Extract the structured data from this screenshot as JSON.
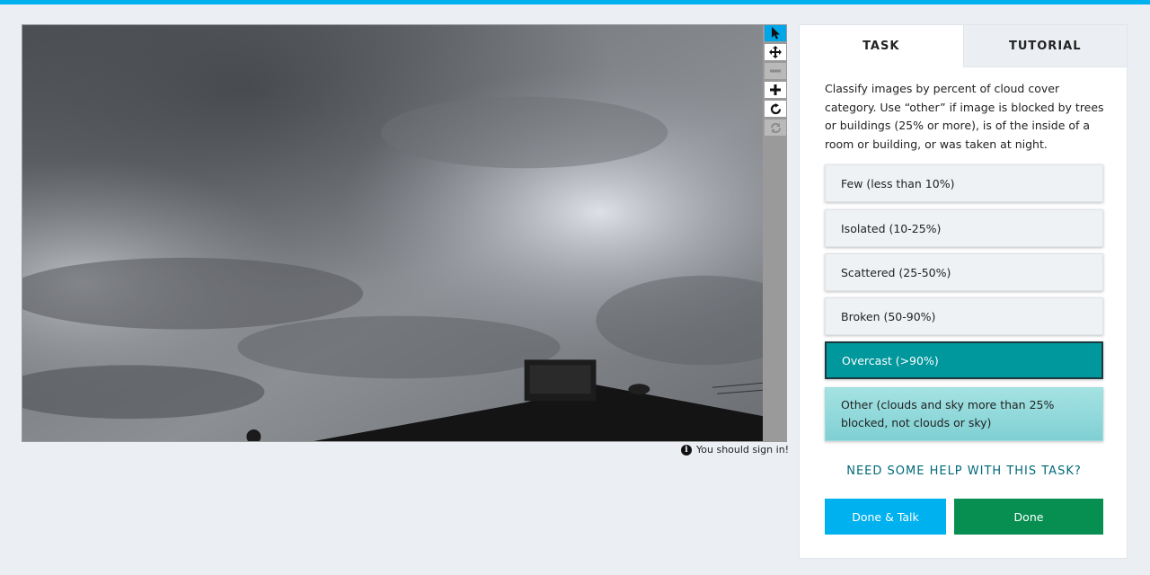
{
  "colors": {
    "accent_bar": "#00b1f0",
    "selected_answer": "#00979d",
    "done_talk_button": "#00b1f0",
    "done_button": "#078f52",
    "help_link": "#00697a"
  },
  "viewer": {
    "tools": [
      {
        "icon": "pointer-icon",
        "state": "active"
      },
      {
        "icon": "move-icon",
        "state": "enabled"
      },
      {
        "icon": "zoom-out-icon",
        "state": "disabled"
      },
      {
        "icon": "zoom-in-icon",
        "state": "enabled"
      },
      {
        "icon": "rotate-icon",
        "state": "enabled"
      },
      {
        "icon": "reset-icon",
        "state": "disabled"
      }
    ],
    "signin_message": "You should sign in!"
  },
  "panel": {
    "tabs": [
      {
        "label": "TASK",
        "active": true
      },
      {
        "label": "TUTORIAL",
        "active": false
      }
    ],
    "instructions": "Classify images by percent of cloud cover category. Use “other” if image is blocked by trees or buildings (25% or more), is of the inside of a room or building, or was taken at night.",
    "answers": [
      {
        "label": "Few (less than 10%)",
        "selected": false
      },
      {
        "label": "Isolated (10-25%)",
        "selected": false
      },
      {
        "label": "Scattered (25-50%)",
        "selected": false
      },
      {
        "label": "Broken (50-90%)",
        "selected": false
      },
      {
        "label": "Overcast (>90%)",
        "selected": true
      },
      {
        "label": "Other (clouds and sky more than 25% blocked, not clouds or sky)",
        "selected": false
      }
    ],
    "help_link": "NEED SOME HELP WITH THIS TASK?",
    "done_talk_label": "Done & Talk",
    "done_label": "Done"
  }
}
